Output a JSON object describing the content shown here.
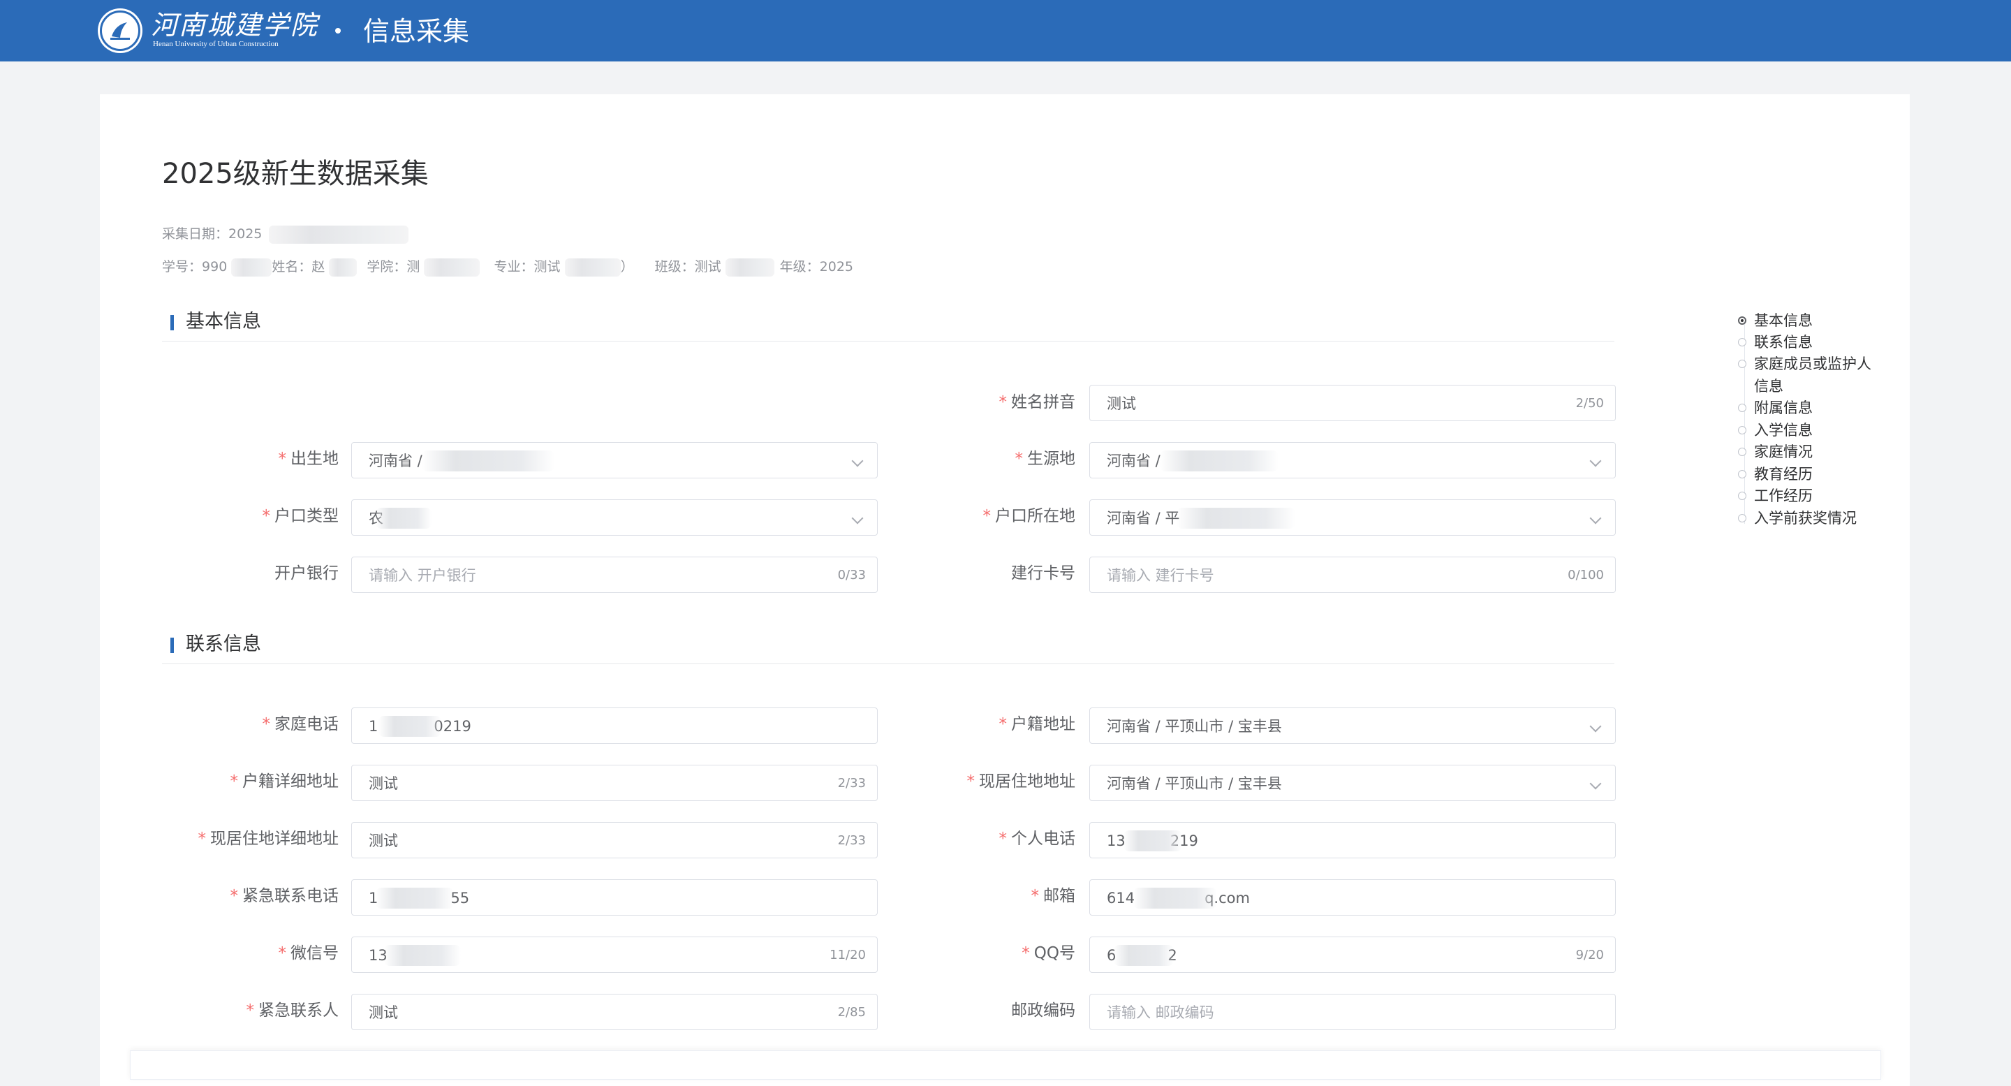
{
  "header": {
    "logo_cn": "河南城建学院",
    "logo_en": "Henan University of Urban Construction",
    "app_title": "信息采集"
  },
  "page": {
    "title": "2025级新生数据采集",
    "collect_date_label": "采集日期：",
    "collect_date_value": "2025",
    "student_id_label": "学号：",
    "student_id_value": "990",
    "name_label": "姓名：",
    "name_value": "赵",
    "college_label": "学院：",
    "college_value": "测",
    "major_label": "专业：",
    "major_value": "测试",
    "major_suffix": "）",
    "class_label": "班级：",
    "class_value": "测试",
    "grade_label": "年级：",
    "grade_value": "2025"
  },
  "sections": {
    "basic": "基本信息",
    "contact": "联系信息"
  },
  "basic_fields": {
    "pinyin": {
      "label": "姓名拼音",
      "value": "测试",
      "count": "2/50"
    },
    "birthplace": {
      "label": "出生地",
      "value": "河南省 /"
    },
    "origin": {
      "label": "生源地",
      "value": "河南省 /"
    },
    "hukou_type": {
      "label": "户口类型",
      "value": "农"
    },
    "hukou_location": {
      "label": "户口所在地",
      "value": "河南省 / 平"
    },
    "bank": {
      "label": "开户银行",
      "placeholder": "请输入 开户银行",
      "count": "0/33"
    },
    "ccb_card": {
      "label": "建行卡号",
      "placeholder": "请输入 建行卡号",
      "count": "0/100"
    }
  },
  "contact_fields": {
    "home_phone": {
      "label": "家庭电话",
      "value_prefix": "1",
      "value_suffix": "0219"
    },
    "hukou_address": {
      "label": "户籍地址",
      "value": "河南省 / 平顶山市 / 宝丰县"
    },
    "hukou_detail": {
      "label": "户籍详细地址",
      "value": "测试",
      "count": "2/33"
    },
    "residence": {
      "label": "现居住地地址",
      "value": "河南省 / 平顶山市 / 宝丰县"
    },
    "residence_detail": {
      "label": "现居住地详细地址",
      "value": "测试",
      "count": "2/33"
    },
    "personal_phone": {
      "label": "个人电话",
      "value_prefix": "13",
      "value_suffix": "219"
    },
    "emergency_phone": {
      "label": "紧急联系电话",
      "value_prefix": "1",
      "value_suffix": "55"
    },
    "email": {
      "label": "邮箱",
      "value_prefix": "614",
      "value_suffix": "q.com"
    },
    "wechat": {
      "label": "微信号",
      "value_prefix": "13",
      "count": "11/20"
    },
    "qq": {
      "label": "QQ号",
      "value_prefix": "6",
      "value_suffix": "2",
      "count": "9/20"
    },
    "emergency_contact": {
      "label": "紧急联系人",
      "value": "测试",
      "count": "2/85"
    },
    "postcode": {
      "label": "邮政编码",
      "placeholder": "请输入 邮政编码"
    }
  },
  "anchor_nav": {
    "active_index": 0,
    "items": [
      "基本信息",
      "联系信息",
      "家庭成员或监护人",
      "信息",
      "附属信息",
      "入学信息",
      "家庭情况",
      "教育经历",
      "工作经历",
      "入学前获奖情况"
    ]
  },
  "colors": {
    "brand": "#2b6bb8",
    "required": "#f56c6c",
    "page_bg": "#f2f3f5"
  }
}
